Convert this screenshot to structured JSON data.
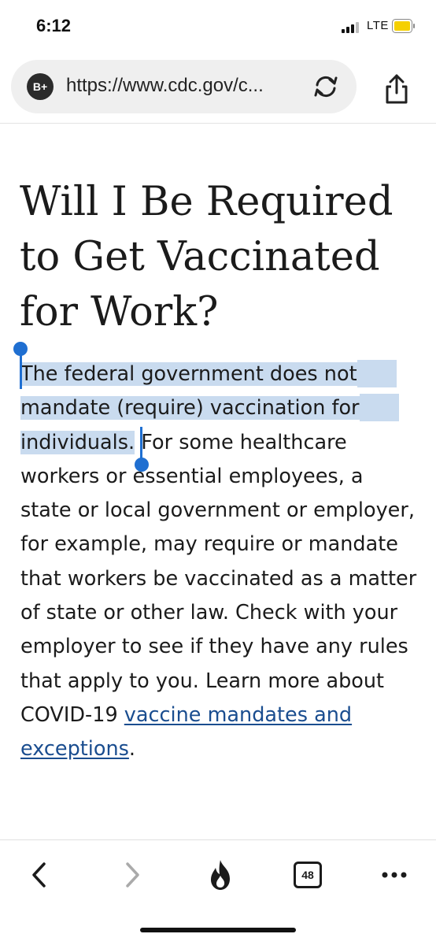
{
  "status_bar": {
    "time": "6:12",
    "network": "LTE"
  },
  "browser": {
    "site_badge": "B+",
    "url": "https://www.cdc.gov/c..."
  },
  "article": {
    "title": "Will I Be Required to Get Vaccinated for Work?",
    "selected_text_line1": "The federal government does not",
    "selected_text_line2": "mandate (require) vaccination for",
    "selected_text_line3": "individuals.",
    "body_text": " For some healthcare workers or essential employees, a state or local government or employer, for example, may require or mandate that workers be vaccinated as a matter of state or other law. Check with your employer to see if they have any rules that apply to you. Learn more about COVID-19 ",
    "link_text": "vaccine mandates and exceptions",
    "trailing_text": "."
  },
  "toolbar": {
    "tab_count": "48"
  },
  "colors": {
    "selection": "#c9dbef",
    "handle": "#1f6fd1",
    "link": "#1a4d8f"
  },
  "icons": [
    "site-badge-icon",
    "reload-icon",
    "share-icon",
    "back-icon",
    "forward-icon",
    "flame-icon",
    "tabs-icon",
    "more-icon"
  ]
}
